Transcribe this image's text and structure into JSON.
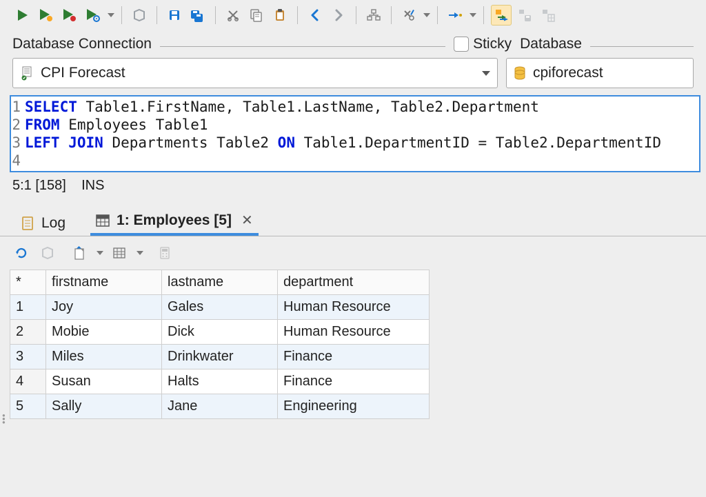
{
  "toolbar": {
    "sticky_label": "Sticky"
  },
  "connection": {
    "label": "Database Connection",
    "selected": "CPI Forecast"
  },
  "database": {
    "label": "Database",
    "selected": "cpiforecast"
  },
  "sql": {
    "lines": [
      [
        {
          "t": "kw",
          "v": "SELECT"
        },
        {
          "t": "sp",
          "v": " "
        },
        {
          "t": "p",
          "v": "Table1.FirstName, Table1.LastName, Table2.Department"
        }
      ],
      [
        {
          "t": "kw",
          "v": "FROM"
        },
        {
          "t": "sp",
          "v": " "
        },
        {
          "t": "p",
          "v": "Employees Table1"
        }
      ],
      [
        {
          "t": "kw",
          "v": "LEFT JOIN"
        },
        {
          "t": "sp",
          "v": " "
        },
        {
          "t": "p",
          "v": "Departments Table2 "
        },
        {
          "t": "kw",
          "v": "ON"
        },
        {
          "t": "sp",
          "v": " "
        },
        {
          "t": "p",
          "v": "Table1.DepartmentID = Table2.DepartmentID"
        }
      ],
      []
    ]
  },
  "status": {
    "cursor": "5:1 [158]",
    "mode": "INS"
  },
  "tabs": {
    "log": "Log",
    "result": "1: Employees [5]"
  },
  "results": {
    "columns": [
      "firstname",
      "lastname",
      "department"
    ],
    "rows": [
      {
        "n": "1",
        "firstname": "Joy",
        "lastname": "Gales",
        "department": "Human Resource"
      },
      {
        "n": "2",
        "firstname": "Mobie",
        "lastname": "Dick",
        "department": "Human Resource"
      },
      {
        "n": "3",
        "firstname": "Miles",
        "lastname": "Drinkwater",
        "department": "Finance"
      },
      {
        "n": "4",
        "firstname": "Susan",
        "lastname": "Halts",
        "department": "Finance"
      },
      {
        "n": "5",
        "firstname": "Sally",
        "lastname": "Jane",
        "department": "Engineering"
      }
    ]
  }
}
